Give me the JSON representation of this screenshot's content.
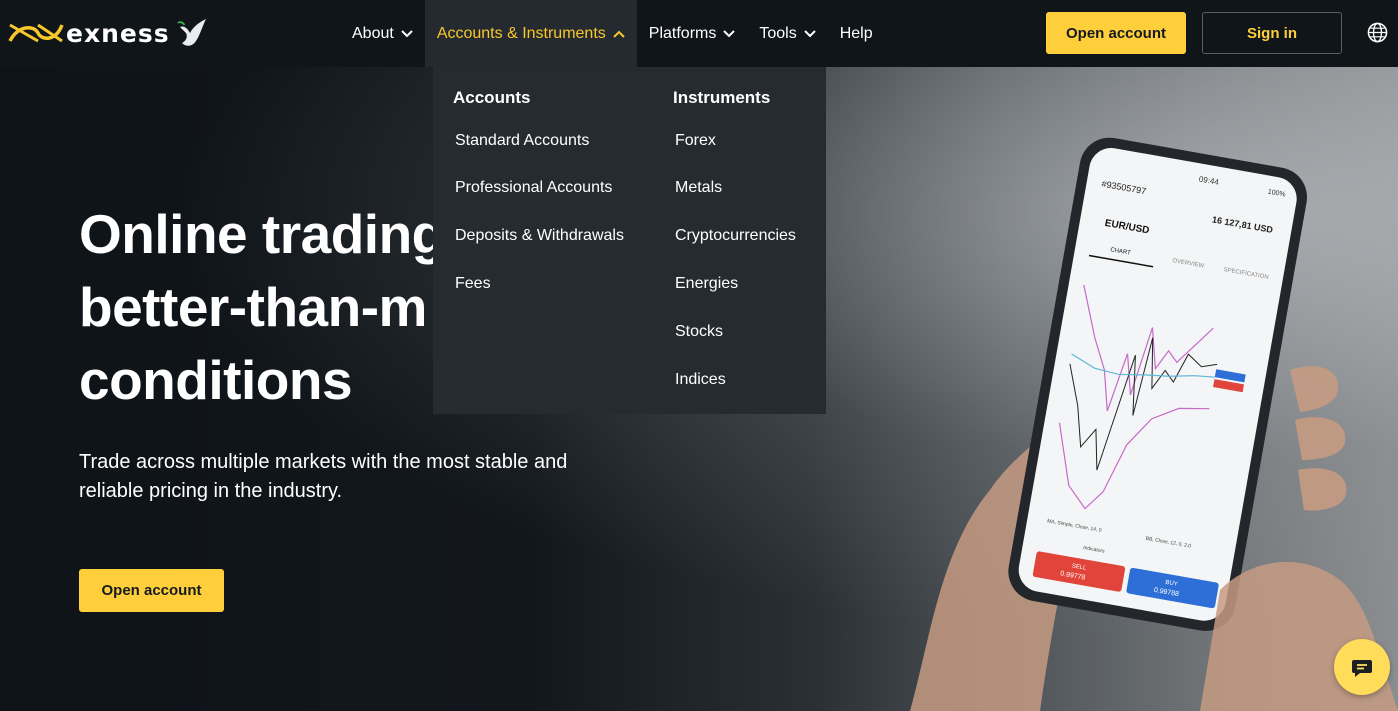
{
  "brand": {
    "name": "exness",
    "accent": "#ffcf3b"
  },
  "nav": {
    "items": [
      {
        "label": "About",
        "has_chevron": true
      },
      {
        "label": "Accounts & Instruments",
        "has_chevron": true,
        "active": true
      },
      {
        "label": "Platforms",
        "has_chevron": true
      },
      {
        "label": "Tools",
        "has_chevron": true
      },
      {
        "label": "Help",
        "has_chevron": false
      }
    ],
    "open_account_label": "Open account",
    "sign_in_label": "Sign in",
    "language_icon": "globe-icon"
  },
  "dropdown": {
    "accounts": {
      "heading": "Accounts",
      "items": [
        "Standard Accounts",
        "Professional Accounts",
        "Deposits & Withdrawals",
        "Fees"
      ]
    },
    "instruments": {
      "heading": "Instruments",
      "items": [
        "Forex",
        "Metals",
        "Cryptocurrencies",
        "Energies",
        "Stocks",
        "Indices"
      ]
    }
  },
  "hero": {
    "title_lines": [
      "Online trading",
      "better-than-m",
      "conditions"
    ],
    "subtitle": "Trade across multiple markets with the most stable and reliable pricing in the industry.",
    "cta_label": "Open account"
  },
  "phone": {
    "account_id": "#93505797",
    "balance": "16 127,81 USD",
    "symbol": "EUR/USD",
    "tabs": [
      "CHART",
      "OVERVIEW",
      "SPECIFICATION"
    ],
    "indicator_1": "MA, Simple, Close, 14, 0",
    "indicator_2": "BB, Close, 12, 0, 2.0",
    "indicators_label": "Indicators",
    "sell_label": "SELL",
    "sell_price": "0.99778",
    "buy_label": "BUY",
    "buy_price": "0.99788",
    "time": "09:44",
    "battery": "100%"
  },
  "chat": {
    "icon": "chat-bubble-icon"
  }
}
